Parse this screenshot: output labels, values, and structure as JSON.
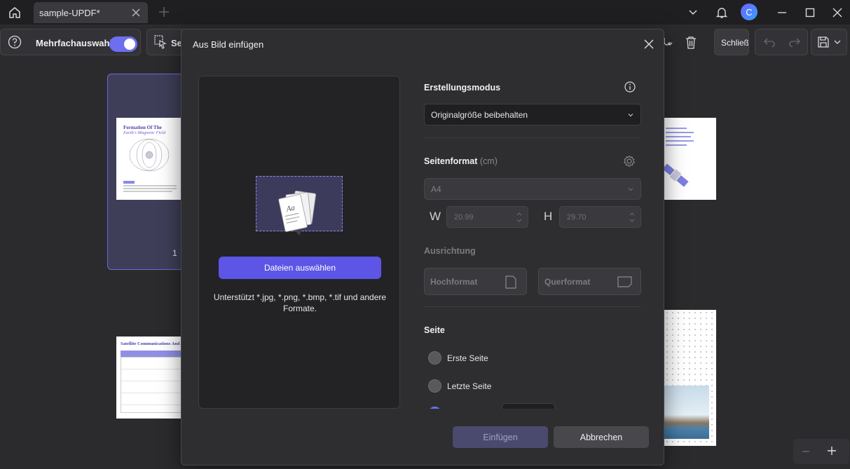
{
  "tab": {
    "title": "sample-UPDF*"
  },
  "user": {
    "avatar_letter": "C"
  },
  "toolbar": {
    "multiselect_label": "Mehrfachauswahl",
    "select_label_partial": "Se",
    "close_label_partial": "Schließ"
  },
  "pages": [
    {
      "number": "1",
      "title_line1": "Formation Of The",
      "title_line2": "Earth's Magnetic Field"
    },
    {
      "title": "Satellite Communications And A"
    }
  ],
  "dialog": {
    "title": "Aus Bild einfügen",
    "choose_files_label": "Dateien auswählen",
    "supported_text": "Unterstützt *.jpg, *.png, *.bmp, *.tif und andere Formate.",
    "creation_mode_heading": "Erstellungsmodus",
    "creation_mode_value": "Originalgröße beibehalten",
    "page_format_heading": "Seitenformat",
    "page_format_unit": "(cm)",
    "page_format_value": "A4",
    "width_label": "W",
    "width_value": "20.99",
    "height_label": "H",
    "height_value": "29.70",
    "orientation_heading": "Ausrichtung",
    "portrait_label": "Hochformat",
    "landscape_label": "Querformat",
    "page_heading": "Seite",
    "first_page_label": "Erste Seite",
    "last_page_label": "Letzte Seite",
    "insert_label": "Einfügen",
    "cancel_label": "Abbrechen"
  },
  "colors": {
    "accent": "#5c55e6",
    "background": "#2b2b2e",
    "dialog": "#2e2e31"
  }
}
